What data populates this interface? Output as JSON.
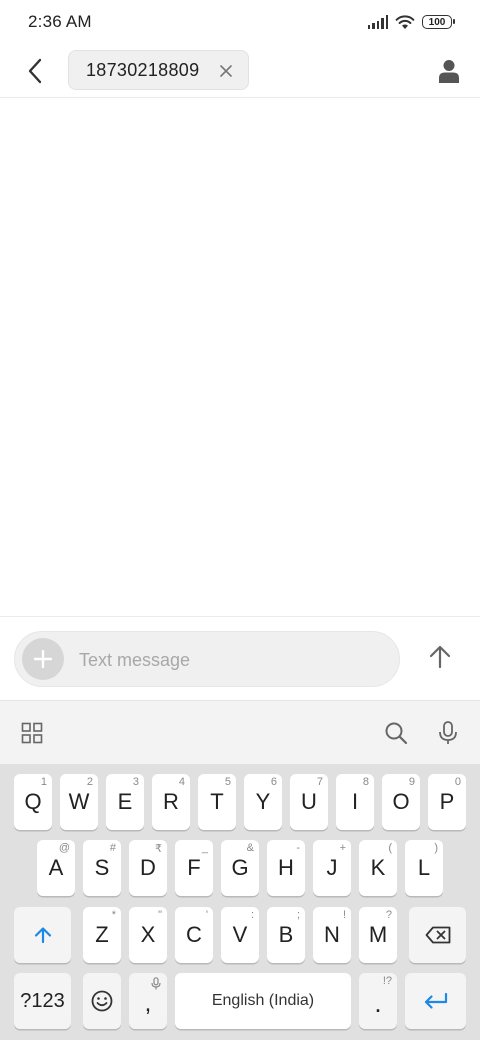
{
  "status_bar": {
    "time": "2:36 AM",
    "battery": "100",
    "signal_icon": "signal-icon",
    "wifi_icon": "wifi-icon",
    "battery_icon": "battery-icon"
  },
  "header": {
    "recipient": "18730218809",
    "back_icon": "back-arrow-icon",
    "remove_icon": "close-icon",
    "contact_icon": "person-icon"
  },
  "composer": {
    "placeholder": "Text message",
    "value": "",
    "attach_icon": "plus-icon",
    "send_icon": "arrow-up-icon"
  },
  "keyboard_toolbar": {
    "menu_icon": "grid-icon",
    "search_icon": "search-icon",
    "voice_icon": "microphone-icon"
  },
  "keyboard": {
    "row1": [
      {
        "label": "Q",
        "hint": "1"
      },
      {
        "label": "W",
        "hint": "2"
      },
      {
        "label": "E",
        "hint": "3"
      },
      {
        "label": "R",
        "hint": "4"
      },
      {
        "label": "T",
        "hint": "5"
      },
      {
        "label": "Y",
        "hint": "6"
      },
      {
        "label": "U",
        "hint": "7"
      },
      {
        "label": "I",
        "hint": "8"
      },
      {
        "label": "O",
        "hint": "9"
      },
      {
        "label": "P",
        "hint": "0"
      }
    ],
    "row2": [
      {
        "label": "A",
        "hint": "@"
      },
      {
        "label": "S",
        "hint": "#"
      },
      {
        "label": "D",
        "hint": "₹"
      },
      {
        "label": "F",
        "hint": "_"
      },
      {
        "label": "G",
        "hint": "&"
      },
      {
        "label": "H",
        "hint": "-"
      },
      {
        "label": "J",
        "hint": "+"
      },
      {
        "label": "K",
        "hint": "("
      },
      {
        "label": "L",
        "hint": ")"
      }
    ],
    "row3": [
      {
        "label": "Z",
        "hint": "*"
      },
      {
        "label": "X",
        "hint": "\""
      },
      {
        "label": "C",
        "hint": "'"
      },
      {
        "label": "V",
        "hint": ":"
      },
      {
        "label": "B",
        "hint": ";"
      },
      {
        "label": "N",
        "hint": "!"
      },
      {
        "label": "M",
        "hint": "?"
      }
    ],
    "shift_icon": "shift-arrow-icon",
    "backspace_icon": "backspace-icon",
    "symbols_label": "?123",
    "emoji_icon": "emoji-icon",
    "comma_label": ",",
    "comma_hint_icon": "microphone-icon",
    "space_label": "English (India)",
    "period_label": ".",
    "period_hint": "!?",
    "enter_icon": "enter-icon"
  },
  "colors": {
    "accent": "#1e88e5",
    "keyboard_bg": "#e0e0e0",
    "key_bg": "#ffffff"
  }
}
